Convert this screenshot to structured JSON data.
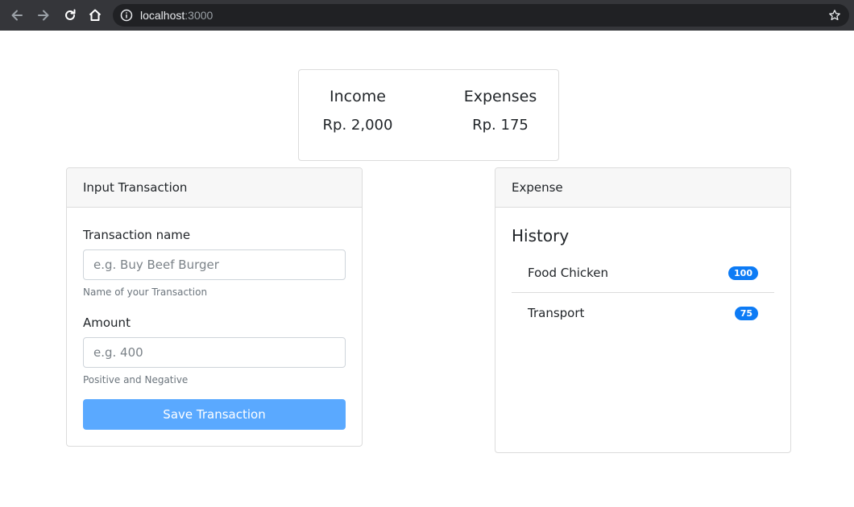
{
  "browser": {
    "url_host": "localhost",
    "url_port": ":3000",
    "icons": [
      "back-arrow-icon",
      "forward-arrow-icon",
      "reload-icon",
      "home-icon",
      "site-info-icon",
      "bookmark-star-icon"
    ]
  },
  "summary": {
    "income_label": "Income",
    "income_value": "Rp. 2,000",
    "expenses_label": "Expenses",
    "expenses_value": "Rp. 175"
  },
  "input_card": {
    "header": "Input Transaction",
    "name_label": "Transaction name",
    "name_placeholder": "e.g. Buy Beef Burger",
    "name_help": "Name of your Transaction",
    "amount_label": "Amount",
    "amount_placeholder": "e.g. 400",
    "amount_help": "Positive and Negative",
    "save_label": "Save Transaction"
  },
  "expense_card": {
    "header": "Expense",
    "history_title": "History",
    "items": [
      {
        "name": "Food Chicken",
        "amount": "100"
      },
      {
        "name": "Transport",
        "amount": "75"
      }
    ]
  },
  "colors": {
    "chrome_bg": "#35363a",
    "omnibox_bg": "#202124",
    "primary_button": "#5aa9ff",
    "badge": "#0d7bf5",
    "card_header_bg": "#f7f7f7"
  }
}
